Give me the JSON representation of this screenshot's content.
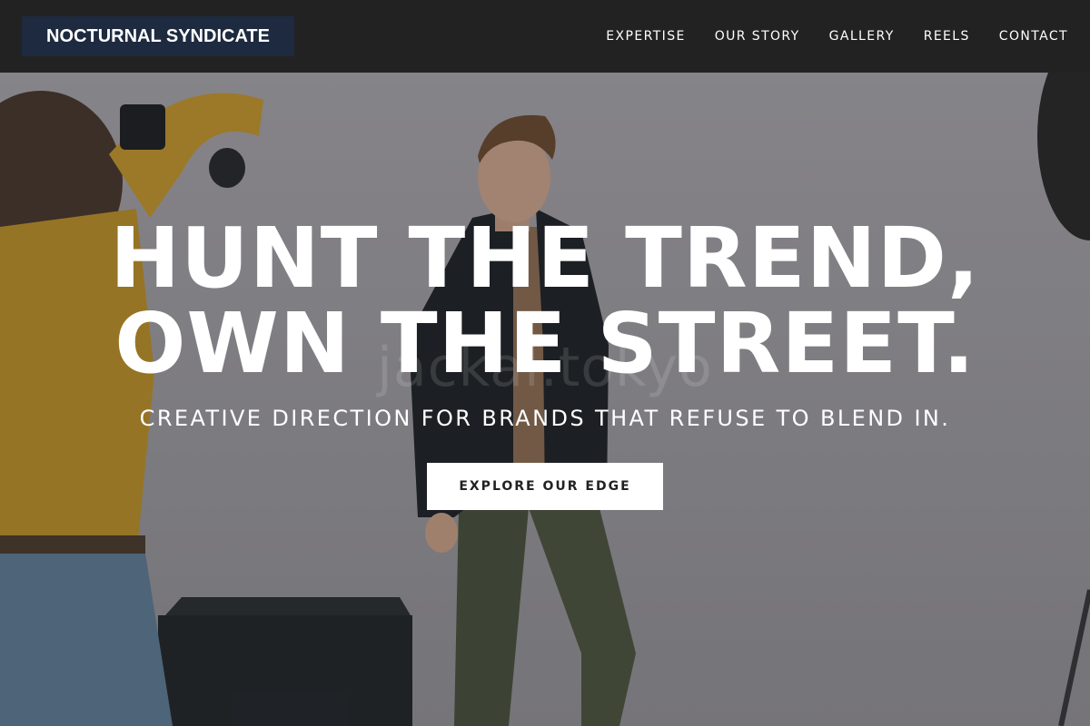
{
  "brand": {
    "name": "NOCTURNAL SYNDICATE"
  },
  "nav": {
    "items": [
      {
        "label": "EXPERTISE"
      },
      {
        "label": "OUR STORY"
      },
      {
        "label": "GALLERY"
      },
      {
        "label": "REELS"
      },
      {
        "label": "CONTACT"
      }
    ]
  },
  "hero": {
    "headline_line1": "HUNT THE TREND,",
    "headline_line2": "OWN THE STREET.",
    "subheadline": "CREATIVE DIRECTION FOR BRANDS THAT REFUSE TO BLEND IN.",
    "cta_label": "EXPLORE OUR EDGE",
    "watermark": "jackal.tokyo"
  },
  "colors": {
    "header_bg": "#222222",
    "logo_bg": "#1d2a3f",
    "text": "#ffffff",
    "cta_bg": "#ffffff",
    "cta_text": "#222222"
  }
}
